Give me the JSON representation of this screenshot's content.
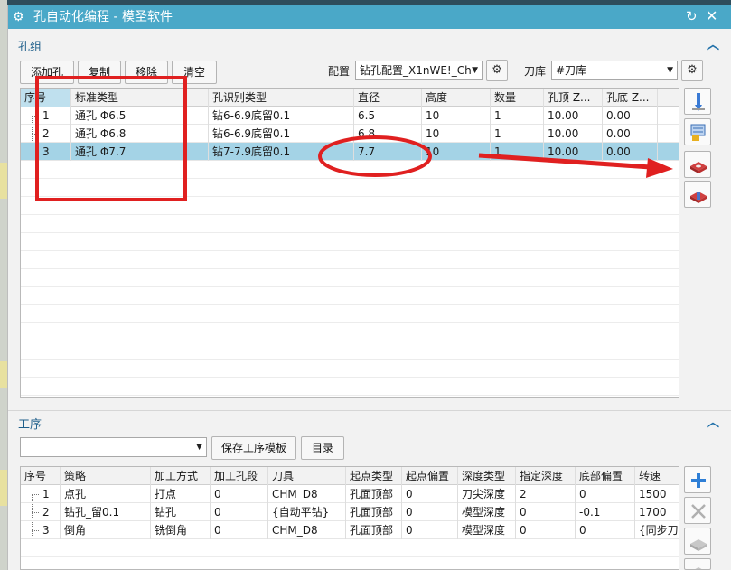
{
  "title": "孔自动化编程 - 模圣软件",
  "hole_group": {
    "section_label": "孔组",
    "buttons": {
      "add_hole": "添加孔",
      "copy": "复制",
      "remove": "移除",
      "clear": "清空"
    },
    "config_label": "配置",
    "config_value": "钻孔配置_X1nWE!_Ch",
    "tool_lib_label": "刀库",
    "tool_lib_value": "#刀库",
    "columns": [
      "序号",
      "标准类型",
      "孔识别类型",
      "直径",
      "高度",
      "数量",
      "孔顶 Z...",
      "孔底 Z..."
    ],
    "rows": [
      [
        "1",
        "通孔 Φ6.5",
        "钻6-6.9底留0.1",
        "6.5",
        "10",
        "1",
        "10.00",
        "0.00"
      ],
      [
        "2",
        "通孔 Φ6.8",
        "钻6-6.9底留0.1",
        "6.8",
        "10",
        "1",
        "10.00",
        "0.00"
      ],
      [
        "3",
        "通孔 Φ7.7",
        "钻7-7.9底留0.1",
        "7.7",
        "10",
        "1",
        "10.00",
        "0.00"
      ]
    ],
    "selected_row": 2
  },
  "operations": {
    "section_label": "工序",
    "template_value": "",
    "buttons": {
      "save_template": "保存工序模板",
      "catalog": "目录"
    },
    "columns": [
      "序号",
      "策略",
      "加工方式",
      "加工孔段",
      "刀具",
      "起点类型",
      "起点偏置",
      "深度类型",
      "指定深度",
      "底部偏置",
      "转速"
    ],
    "rows": [
      [
        "1",
        "点孔",
        "打点",
        "0",
        "CHM_D8",
        "孔面顶部",
        "0",
        "刀尖深度",
        "2",
        "0",
        "1500"
      ],
      [
        "2",
        "钻孔_留0.1",
        "钻孔",
        "0",
        "{自动平钻}",
        "孔面顶部",
        "0",
        "模型深度",
        "0",
        "-0.1",
        "1700"
      ],
      [
        "3",
        "倒角",
        "铣倒角",
        "0",
        "CHM_D8",
        "孔面顶部",
        "0",
        "模型深度",
        "0",
        "0",
        "{同步刀库"
      ]
    ]
  },
  "icons": {
    "title": "gear-icon",
    "reset": "reset-icon",
    "close": "close-icon",
    "collapse": "chevron-up-icon"
  },
  "annotation_color": "#e02020",
  "accent": "#4aa8c8"
}
